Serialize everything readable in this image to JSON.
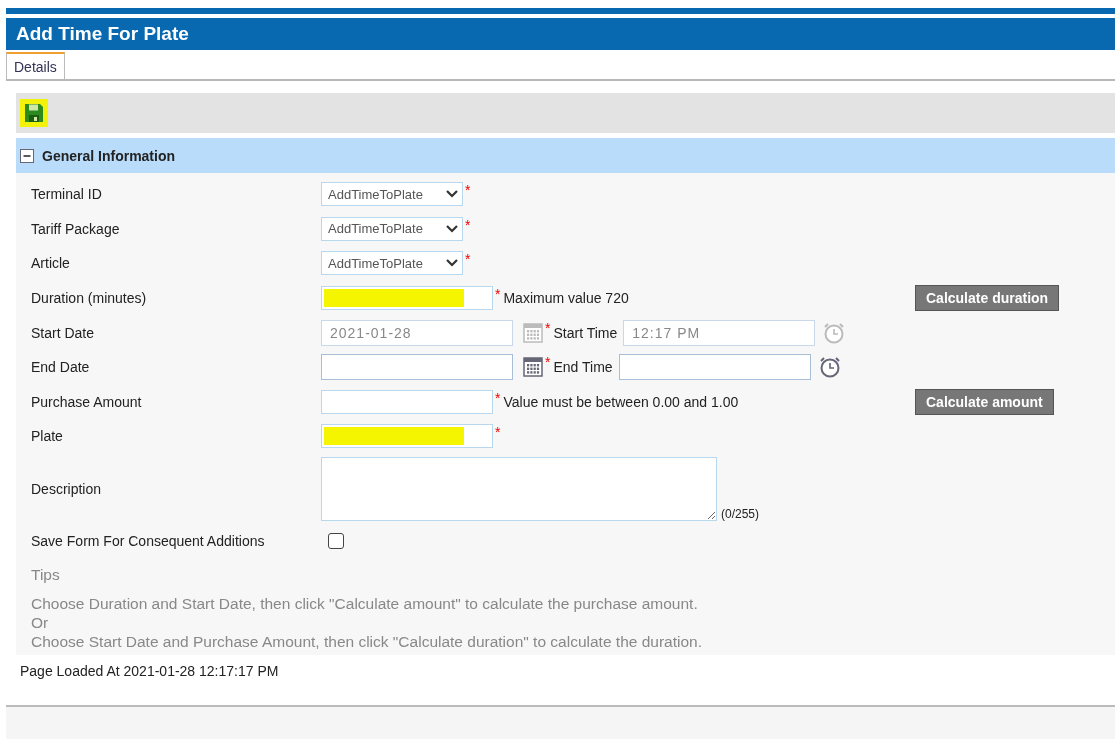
{
  "window": {
    "title": "Add Time For Plate"
  },
  "tabs": [
    {
      "label": "Details",
      "selected": true
    }
  ],
  "toolbar": {
    "save_highlighted": true
  },
  "section": {
    "title": "General Information",
    "expanded": true
  },
  "fields": [
    {
      "kind": "select",
      "label": "Terminal ID",
      "value": "AddTimeToPlate",
      "required_mark": "*"
    },
    {
      "kind": "select",
      "label": "Tariff Package",
      "value": "AddTimeToPlate",
      "required_mark": "*"
    },
    {
      "kind": "select",
      "label": "Article",
      "value": "AddTimeToPlate",
      "required_mark": "*"
    },
    {
      "kind": "text",
      "label": "Duration (minutes)",
      "required_mark": "*",
      "note": "Maximum value 720",
      "button": "Calculate duration",
      "highlighted": true
    },
    {
      "kind": "datetime",
      "label": "Start Date",
      "value": "2021-01-28",
      "disabled": true,
      "required_mark": "*",
      "time_label": "Start Time",
      "time_value": "12:17 PM"
    },
    {
      "kind": "datetime",
      "label": "End Date",
      "disabled": false,
      "required_mark": "*",
      "time_label": "End Time"
    },
    {
      "kind": "text",
      "label": "Purchase Amount",
      "required_mark": "*",
      "note": "Value must be between 0.00 and 1.00",
      "button": "Calculate amount",
      "highlighted": false
    },
    {
      "kind": "text",
      "label": "Plate",
      "required_mark": "*",
      "highlighted": true
    },
    {
      "kind": "textarea",
      "label": "Description",
      "counter": "(0/255)"
    },
    {
      "kind": "checkbox",
      "label": "Save Form For Consequent Additions",
      "checked": false
    }
  ],
  "tips": {
    "title": "Tips",
    "lines": [
      "Choose Duration and Start Date, then click \"Calculate amount\" to calculate the purchase amount.",
      "Or",
      "Choose Start Date and Purchase Amount, then click \"Calculate duration\" to calculate the duration."
    ]
  },
  "footer": "Page Loaded At 2021-01-28 12:17:17 PM"
}
